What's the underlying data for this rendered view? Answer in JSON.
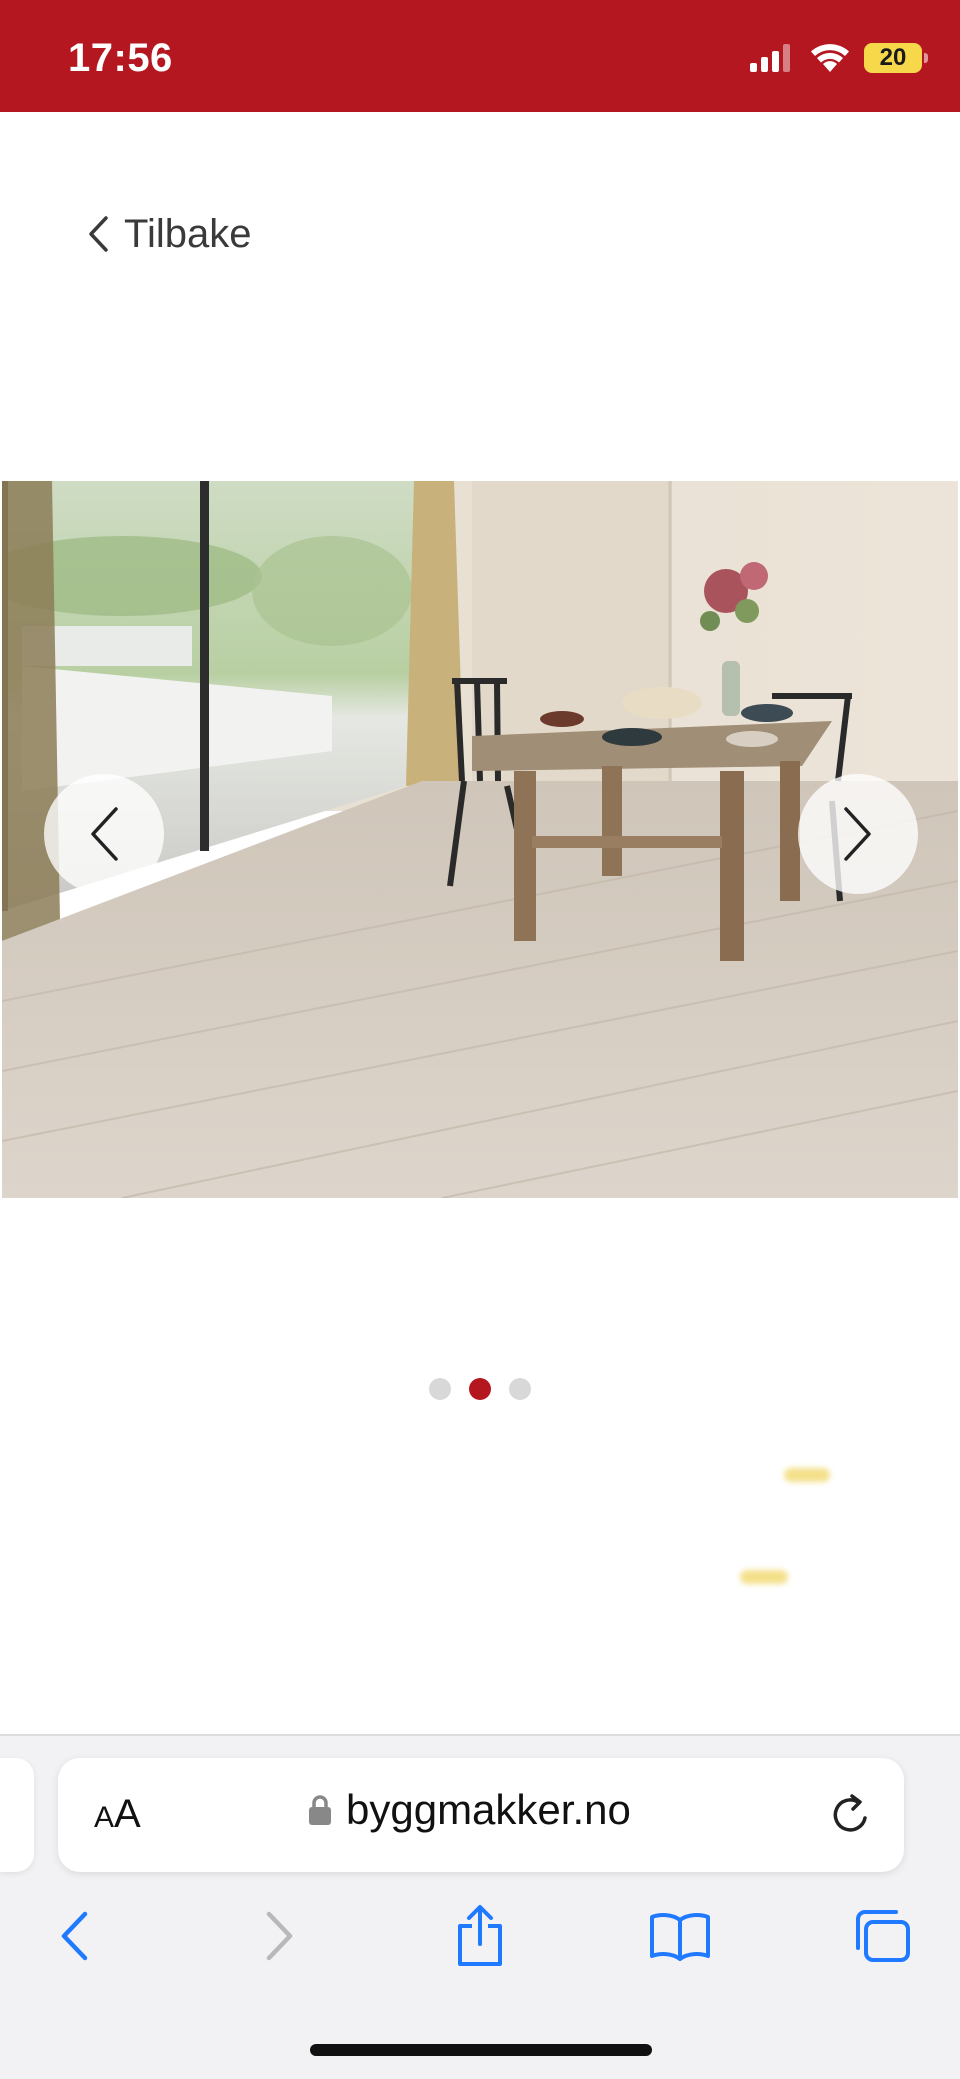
{
  "status_bar": {
    "time": "17:56",
    "battery_level": "20",
    "background_color": "#b51720",
    "icons": [
      "signal-icon",
      "wifi-icon",
      "battery-icon"
    ]
  },
  "back": {
    "label": "Tilbake",
    "icon": "chevron-left-icon"
  },
  "gallery": {
    "image_subject": "product-photo-dining-room-laminate-floor",
    "slide_count": 3,
    "active_slide": 2,
    "prev_icon": "chevron-left-icon",
    "next_icon": "chevron-right-icon",
    "accent_color": "#b51720"
  },
  "browser": {
    "text_size_label_small": "A",
    "text_size_label_large": "A",
    "url": "byggmakker.no",
    "lock_icon": "lock-icon",
    "reload_icon": "reload-icon",
    "toolbar": [
      "back-icon",
      "forward-icon",
      "share-icon",
      "bookmarks-icon",
      "tabs-icon"
    ],
    "accent_color": "#1f7aff"
  }
}
